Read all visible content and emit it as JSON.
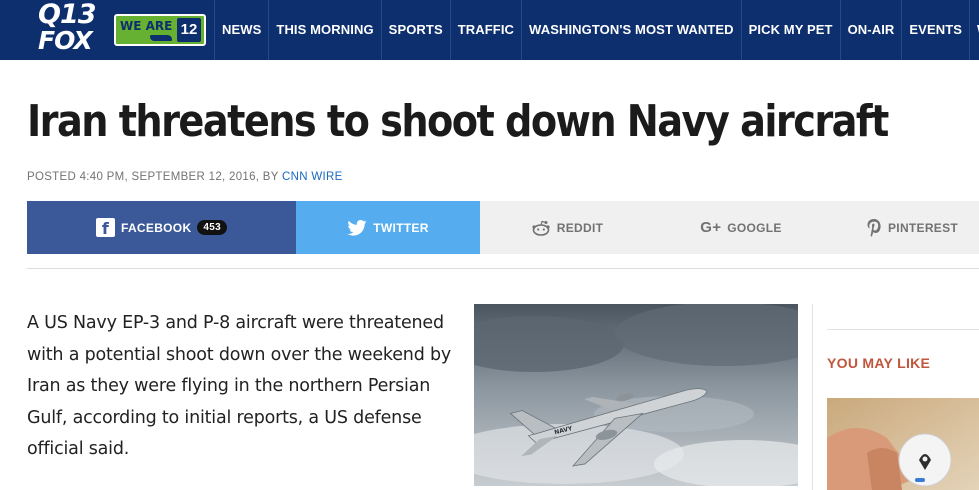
{
  "header": {
    "logo_line1": "Q13",
    "logo_line2": "FOX",
    "badge_text": "WE ARE",
    "badge_number": "12",
    "nav": [
      "NEWS",
      "THIS MORNING",
      "SPORTS",
      "TRAFFIC",
      "WASHINGTON'S MOST WANTED",
      "PICK MY PET",
      "ON-AIR",
      "EVENTS",
      "WEATHER"
    ]
  },
  "article": {
    "headline": "Iran threatens to shoot down Navy aircraft",
    "byline_prefix": "POSTED 4:40 PM, SEPTEMBER 12, 2016, BY ",
    "author": "CNN WIRE",
    "body": "A US Navy EP-3 and P-8 aircraft were threatened with a potential shoot down over the weekend by Iran as they were flying in the northern Persian Gulf, according to initial reports, a US defense official said."
  },
  "share": {
    "facebook": {
      "label": "FACEBOOK",
      "count": "453"
    },
    "twitter": {
      "label": "TWITTER"
    },
    "reddit": {
      "label": "REDDIT"
    },
    "google": {
      "label": "GOOGLE"
    },
    "pinterest": {
      "label": "PINTEREST"
    }
  },
  "sidebar": {
    "title": "YOU MAY LIKE"
  },
  "colors": {
    "nav_bg": "#0d2f6e",
    "facebook": "#3b5998",
    "twitter": "#55acee",
    "author_link": "#1b68c0",
    "sidebar_title": "#c0563b"
  },
  "icons": [
    "facebook-icon",
    "twitter-icon",
    "reddit-icon",
    "google-plus-icon",
    "pinterest-icon"
  ]
}
